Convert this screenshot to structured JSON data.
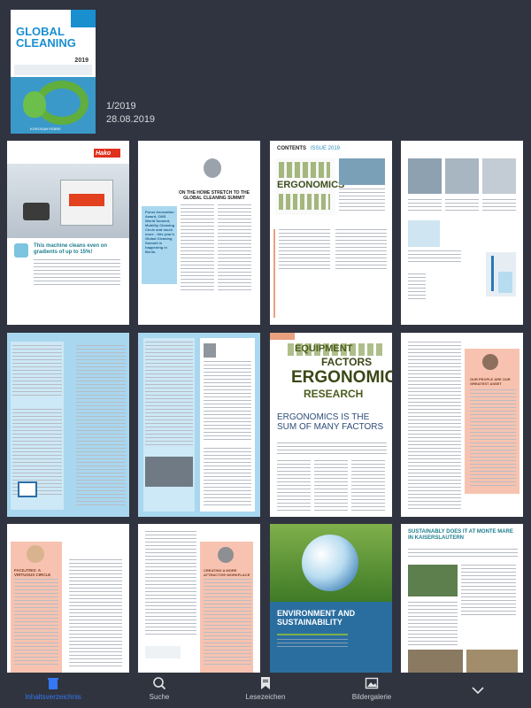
{
  "issue": {
    "number": "1/2019",
    "date": "28.08.2019"
  },
  "cover": {
    "title": "GLOBAL\nCLEANING",
    "year": "2019",
    "caption": "KOROSAM FEBRE"
  },
  "pages": {
    "hoko_ad": {
      "brand": "Hako",
      "headline": "This machine cleans even on gradients of up to 15%!"
    },
    "summit": {
      "headline": "ON THE HOME STRETCH TO THE GLOBAL CLEANING SUMMIT",
      "pull_quote": "Purus Innovation Award, CMS World Summit, Mobility Cleaning Circle and much more - this year's Global Cleaning Summit is happening in Berlin."
    },
    "contents": {
      "title": "CONTENTS",
      "issue_label": "ISSUE 2019",
      "word": "ERGONOMICS"
    },
    "ergonomics_article": {
      "headline": "ERGONOMICS IS THE SUM OF MANY FACTORS",
      "word_main": "ERGONOMICS",
      "word_factors": "FACTORS",
      "word_research": "RESEARCH",
      "word_equipment": "EQUIPMENT"
    },
    "asset_quote": {
      "quote": "OUR PEOPLE ARE OUR GREATEST ASSET"
    },
    "circle": {
      "headline": "FACILITIES: A VIRTUOUS CIRCLE"
    },
    "workplace": {
      "headline": "CREATING A MORE ATTRACTIVE WORKPLACE"
    },
    "environment": {
      "headline": "ENVIRONMENT AND SUSTAINABILITY"
    },
    "sustainability": {
      "headline": "SUSTAINABLY DOES IT AT MONTE MARE IN KAISERSLAUTERN"
    }
  },
  "tabbar": [
    {
      "label": "Inhaltsverzeichnis",
      "icon": "trash-icon",
      "active": true
    },
    {
      "label": "Suche",
      "icon": "search-icon",
      "active": false
    },
    {
      "label": "Lesezeichen",
      "icon": "bookmark-icon",
      "active": false
    },
    {
      "label": "Bildergalerie",
      "icon": "gallery-icon",
      "active": false
    },
    {
      "label": "",
      "icon": "chevron-down-icon",
      "active": false
    }
  ],
  "colors": {
    "accent": "#3478f6",
    "background": "#303440",
    "cover_blue": "#1a8fd0",
    "salmon": "#f7c3b0",
    "light_blue": "#a9d7ef"
  }
}
